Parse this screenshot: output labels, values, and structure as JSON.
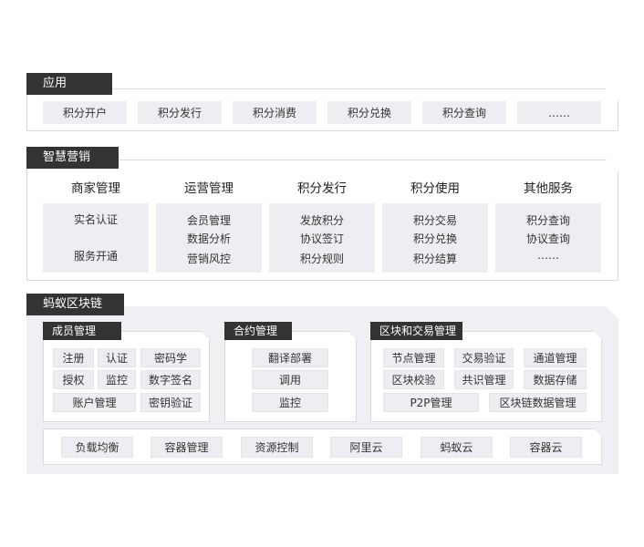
{
  "sections": {
    "app": {
      "title": "应用",
      "items": [
        "积分开户",
        "积分发行",
        "积分消费",
        "积分兑换",
        "积分查询",
        "……"
      ]
    },
    "marketing": {
      "title": "智慧营销",
      "columns": [
        {
          "heading": "商家管理",
          "lines": [
            "实名认证",
            "服务开通"
          ]
        },
        {
          "heading": "运营管理",
          "lines": [
            "会员管理",
            "数据分析",
            "营销风控"
          ]
        },
        {
          "heading": "积分发行",
          "lines": [
            "发放积分",
            "协议签订",
            "积分规则"
          ]
        },
        {
          "heading": "积分使用",
          "lines": [
            "积分交易",
            "积分兑换",
            "积分结算"
          ]
        },
        {
          "heading": "其他服务",
          "lines": [
            "积分查询",
            "协议查询",
            "……"
          ]
        }
      ]
    },
    "blockchain": {
      "title": "蚂蚁区块链",
      "member": {
        "title": "成员管理",
        "items": [
          "注册",
          "认证",
          "密码学",
          "授权",
          "监控",
          "数字签名",
          "账户管理",
          "密钥验证"
        ]
      },
      "contract": {
        "title": "合约管理",
        "items": [
          "翻译部署",
          "调用",
          "监控"
        ]
      },
      "block": {
        "title": "区块和交易管理",
        "items": [
          "节点管理",
          "交易验证",
          "通道管理",
          "区块校验",
          "共识管理",
          "数据存储",
          "P2P管理",
          "区块链数据管理"
        ]
      },
      "infra": {
        "items": [
          "负载均衡",
          "容器管理",
          "资源控制",
          "阿里云",
          "蚂蚁云",
          "容器云"
        ]
      }
    }
  },
  "colors": {
    "tab": "#333333",
    "box": "#eceef1",
    "panel_gray": "#eef0f3",
    "border": "#d9dde2"
  }
}
